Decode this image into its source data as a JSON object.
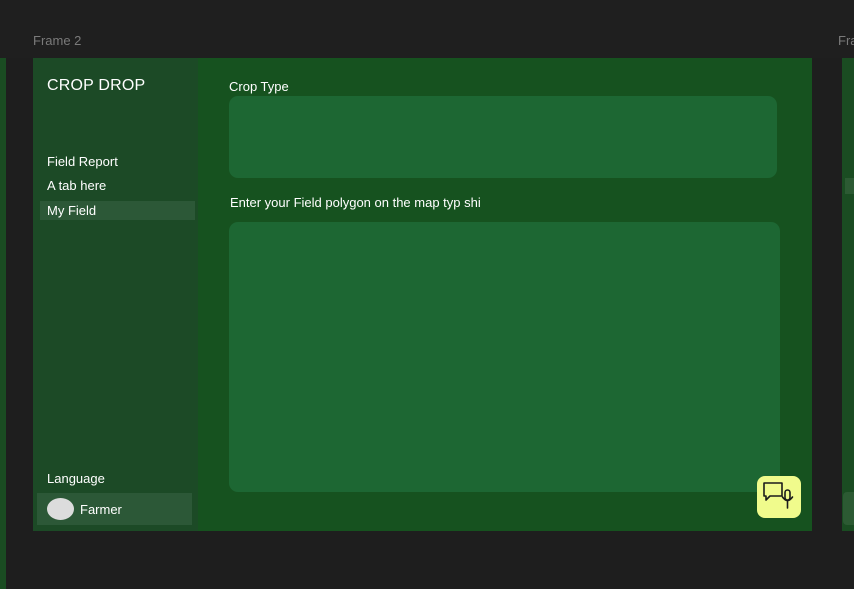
{
  "canvas": {
    "frame_label": "Frame 2",
    "next_frame_label": "Fra"
  },
  "sidebar": {
    "brand": "CROP DROP",
    "items": [
      {
        "label": "Field Report",
        "active": false
      },
      {
        "label": "A tab here",
        "active": false
      },
      {
        "label": "My Field",
        "active": true
      }
    ],
    "language_label": "Language",
    "user": {
      "name": "Farmer",
      "avatar": "avatar-circle"
    }
  },
  "main": {
    "crop_type_label": "Crop Type",
    "crop_type_value": "",
    "map_prompt": "Enter your Field polygon on the map typ shi"
  },
  "voice_button": {
    "icon": "chat-microphone-icon"
  },
  "colors": {
    "background": "#1e1e1e",
    "frame": "#16521f",
    "sidebar": "#1c4a26",
    "active_item": "#2c5837",
    "input": "#1d6733",
    "accent": "#f0fb8c"
  }
}
